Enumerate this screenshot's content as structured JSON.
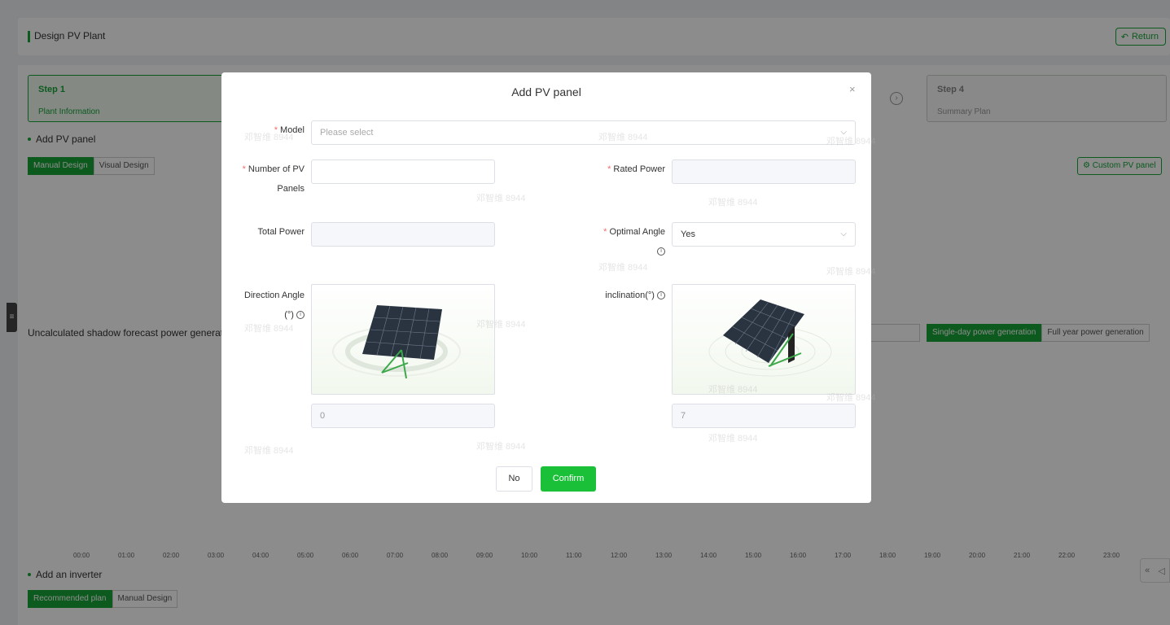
{
  "header": {
    "title": "Design PV Plant",
    "return_label": "Return"
  },
  "steps": {
    "step1": {
      "title": "Step 1",
      "subtitle": "Plant Information"
    },
    "step4": {
      "title": "Step 4",
      "subtitle": "Summary Plan"
    }
  },
  "pv_section": {
    "title": "Add PV panel",
    "tabs": [
      "Manual Design",
      "Visual Design"
    ],
    "custom_button": "Custom PV panel"
  },
  "forecast": {
    "label": "Uncalculated shadow forecast power generation",
    "tabs": [
      "Single-day power generation",
      "Full year power generation"
    ],
    "hours": [
      "00:00",
      "01:00",
      "02:00",
      "03:00",
      "04:00",
      "05:00",
      "06:00",
      "07:00",
      "08:00",
      "09:00",
      "10:00",
      "11:00",
      "12:00",
      "13:00",
      "14:00",
      "15:00",
      "16:00",
      "17:00",
      "18:00",
      "19:00",
      "20:00",
      "21:00",
      "22:00",
      "23:00"
    ]
  },
  "inverter_section": {
    "title": "Add an inverter",
    "tabs": [
      "Recommended plan",
      "Manual Design"
    ]
  },
  "modal": {
    "title": "Add PV panel",
    "close": "×",
    "model_label": "Model",
    "model_placeholder": "Please select",
    "num_panels_label_1": "Number of PV",
    "num_panels_label_2": "Panels",
    "rated_power_label": "Rated Power",
    "total_power_label": "Total Power",
    "optimal_angle_label": "Optimal Angle",
    "optimal_angle_value": "Yes",
    "direction_label_1": "Direction Angle",
    "direction_label_2": "(°)",
    "inclination_label": "inclination(°)",
    "direction_value": "0",
    "inclination_value": "7",
    "no_label": "No",
    "confirm_label": "Confirm"
  },
  "watermark": "邓智维 8944",
  "colors": {
    "accent": "#19a538",
    "confirm": "#19c038",
    "required": "#f56c6c"
  }
}
